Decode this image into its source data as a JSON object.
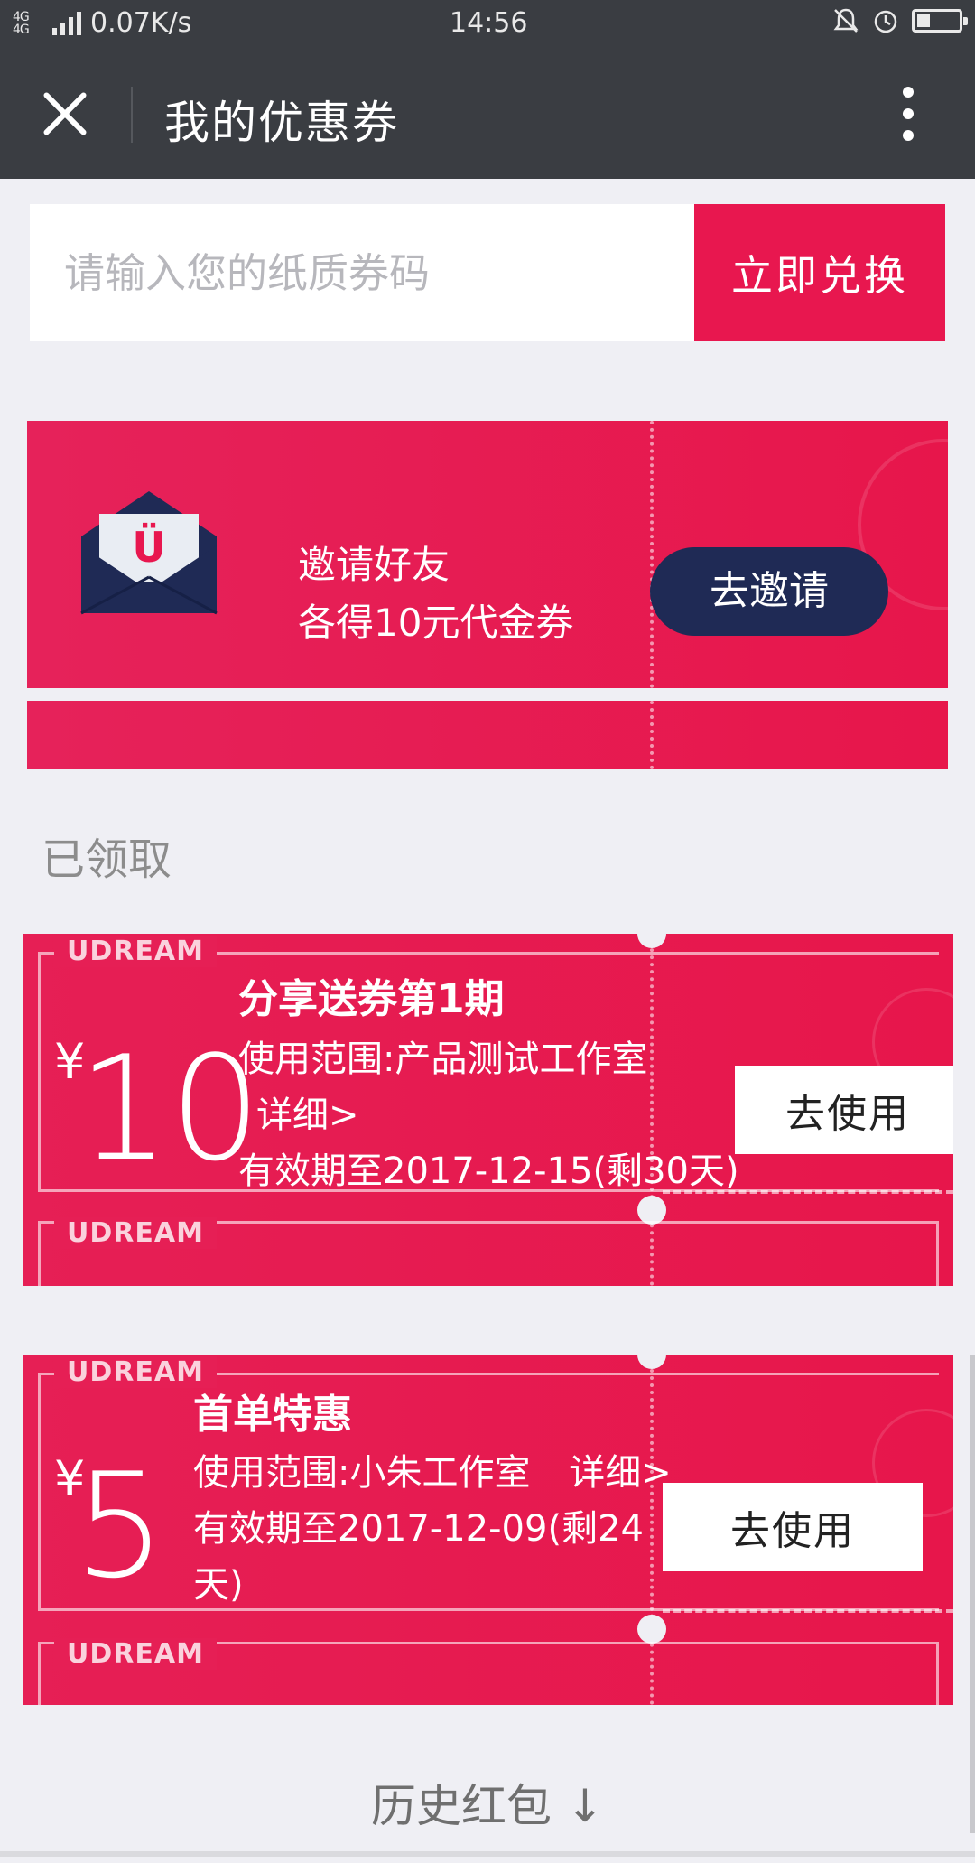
{
  "status_bar": {
    "network_label": "4G 4G",
    "speed": "0.07K/s",
    "time": "14:56",
    "icons": [
      "signal-icon",
      "bell-off-icon",
      "alarm-icon",
      "battery-icon"
    ]
  },
  "header": {
    "title": "我的优惠券",
    "close_icon": "close-icon",
    "more_icon": "more-vertical-icon"
  },
  "redeem": {
    "placeholder": "请输入您的纸质券码",
    "button_label": "立即兑换"
  },
  "invite_card": {
    "line1": "邀请好友",
    "line2": "各得10元代金券",
    "button_label": "去邀请",
    "icon": "envelope-icon"
  },
  "section": {
    "claimed_label": "已领取"
  },
  "coupons": [
    {
      "brand": "UDREAM",
      "currency": "¥",
      "amount": "10",
      "name": "分享送券第1期",
      "scope": "使用范围:产品测试工作室",
      "detail": "详细>",
      "validity": "有效期至2017-12-15(剩30天)",
      "button_label": "去使用"
    },
    {
      "brand": "UDREAM",
      "currency": "¥",
      "amount": "5",
      "name": "首单特惠",
      "scope": "使用范围:小朱工作室",
      "detail": "详细>",
      "validity": "有效期至2017-12-09(剩24天)",
      "button_label": "去使用"
    }
  ],
  "footer": {
    "history_label": "历史红包",
    "arrow": "↓"
  },
  "colors": {
    "header_bg": "#3a3d42",
    "accent_red": "#e8174f",
    "navy": "#1f2a55",
    "page_bg": "#efeff4"
  }
}
